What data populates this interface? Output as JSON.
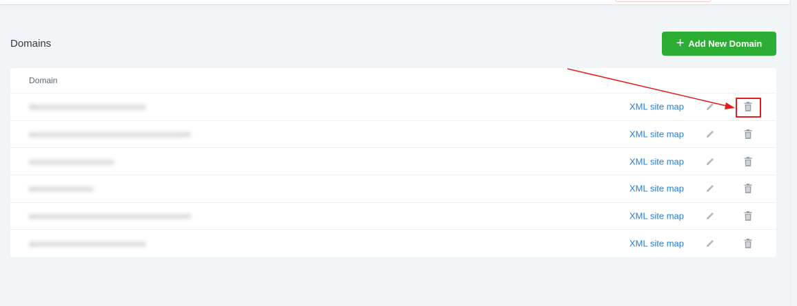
{
  "page": {
    "title": "Domains",
    "add_button_label": "Add New Domain",
    "add_button_icon": "plus-icon"
  },
  "table": {
    "column_header": "Domain",
    "rows": [
      {
        "domain": "dxxxxxxxxxxxxxxxxxxxxxxxxx",
        "link_label": "XML site map"
      },
      {
        "domain": "wxxxxxxxxxxxxxxxxxxxxxxxxxxxxxxxxxm",
        "link_label": "XML site map"
      },
      {
        "domain": "sxxxxxxxxxxxxxxxxxx",
        "link_label": "XML site map"
      },
      {
        "domain": "wxxxxxxxxxxxxx",
        "link_label": "XML site map"
      },
      {
        "domain": "wxxxxxxxxxxxxxxxxxxxxxxxxxxxxxxxxxm",
        "link_label": "XML site map"
      },
      {
        "domain": "axxxxxxxxxxxxxxxxxxxxxxxxx",
        "link_label": "XML site map"
      }
    ],
    "row_icons": [
      "pencil-icon",
      "trash-icon"
    ]
  },
  "annotation": {
    "color": "#e41a1c",
    "target": "trash-icon"
  },
  "colors": {
    "accent_green": "#2cae34",
    "link_blue": "#2a7fd4",
    "background": "#f2f5f8"
  }
}
